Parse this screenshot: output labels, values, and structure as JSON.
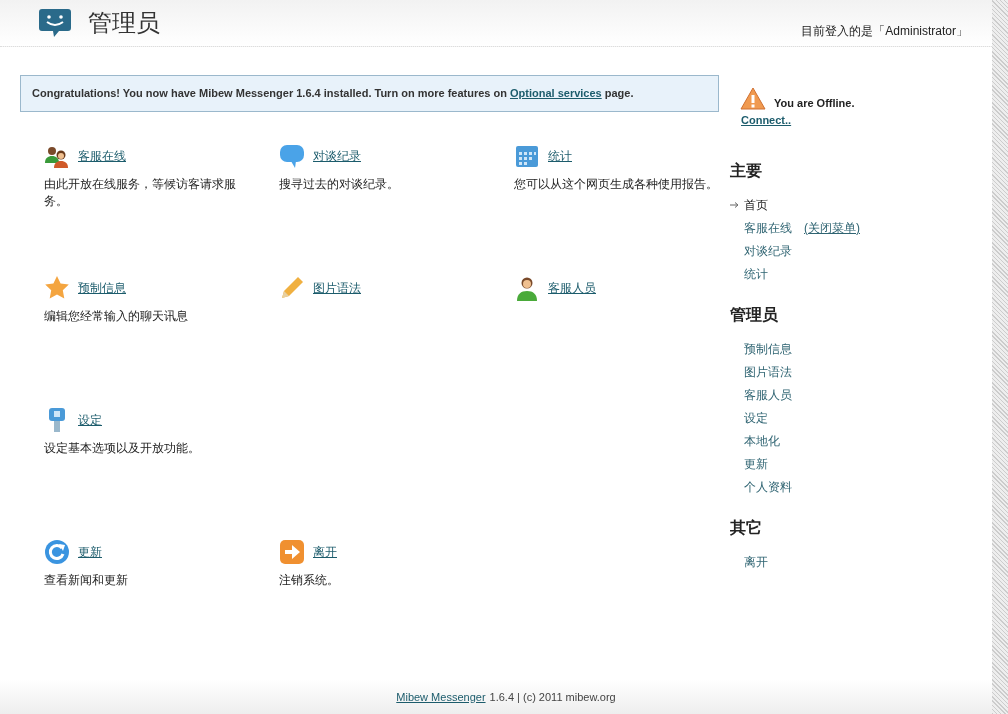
{
  "header": {
    "title": "管理员",
    "login_info": "目前登入的是「Administrator」"
  },
  "notice": {
    "text_before": "Congratulations! You now have Mibew Messenger 1.6.4 installed. Turn on more features on",
    "link": "Optional services",
    "text_after": "page."
  },
  "dashboard": {
    "rows": [
      [
        {
          "label": "客服在线",
          "description": "由此开放在线服务，等候访客请求服务。"
        },
        {
          "label": "对谈纪录",
          "description": "搜寻过去的对谈纪录。"
        },
        {
          "label": "统计",
          "description": "您可以从这个网页生成各种使用报告。"
        }
      ],
      [
        {
          "label": "预制信息",
          "description": "编辑您经常输入的聊天讯息"
        },
        {
          "label": "图片语法"
        },
        {
          "label": "客服人员"
        }
      ],
      [
        {
          "label": "设定",
          "description": "设定基本选项以及开放功能。"
        }
      ],
      [
        {
          "label": "更新",
          "description": "查看新闻和更新"
        },
        {
          "label": "离开",
          "description": "注销系统。"
        }
      ]
    ]
  },
  "sidebar": {
    "status": {
      "text": "You are Offline.",
      "link": "Connect.."
    },
    "sections": [
      {
        "title": "主要",
        "items": [
          {
            "label": "首页",
            "selected": true
          },
          {
            "label": "客服在线",
            "extra": "(关闭菜单)",
            "selected": false
          },
          {
            "label": "对谈纪录",
            "selected": false
          },
          {
            "label": "统计",
            "selected": false
          }
        ]
      },
      {
        "title": "管理员",
        "items": [
          {
            "label": "预制信息",
            "selected": false
          },
          {
            "label": "图片语法",
            "selected": false
          },
          {
            "label": "客服人员",
            "selected": false
          },
          {
            "label": "设定",
            "selected": false
          },
          {
            "label": "本地化",
            "selected": false
          },
          {
            "label": "更新",
            "selected": false
          },
          {
            "label": "个人资料",
            "selected": false
          }
        ]
      },
      {
        "title": "其它",
        "items": [
          {
            "label": "离开",
            "selected": false
          }
        ]
      }
    ]
  },
  "footer": {
    "link": "Mibew Messenger",
    "text": "1.6.4 | (c) 2011 mibew.org"
  }
}
